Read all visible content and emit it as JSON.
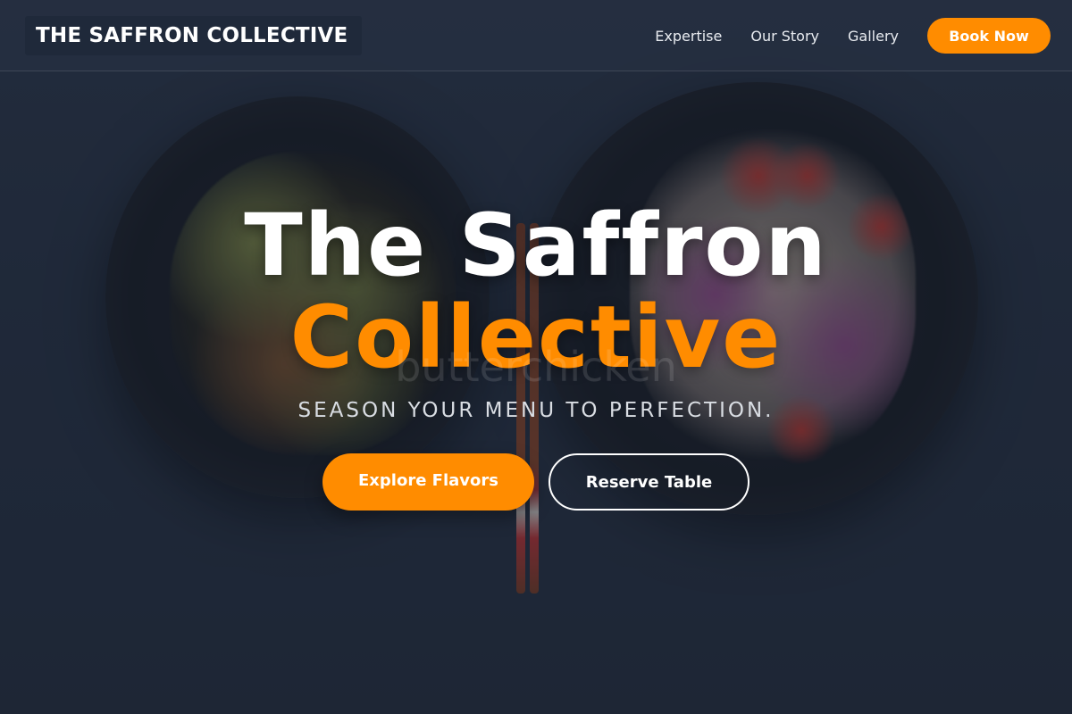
{
  "navbar": {
    "logo": "THE SAFFRON COLLECTIVE",
    "links": [
      "Expertise",
      "Our Story",
      "Gallery"
    ],
    "cta_label": "Book Now"
  },
  "hero": {
    "title_line1": "The Saffron",
    "title_line2": "Collective",
    "watermark": "butterchicken",
    "tagline": "SEASON YOUR MENU TO PERFECTION.",
    "primary_cta": "Explore Flavors",
    "secondary_cta": "Reserve Table"
  },
  "colors": {
    "accent": "#ff8c00",
    "background": "#1e2633",
    "text": "#ffffff"
  }
}
